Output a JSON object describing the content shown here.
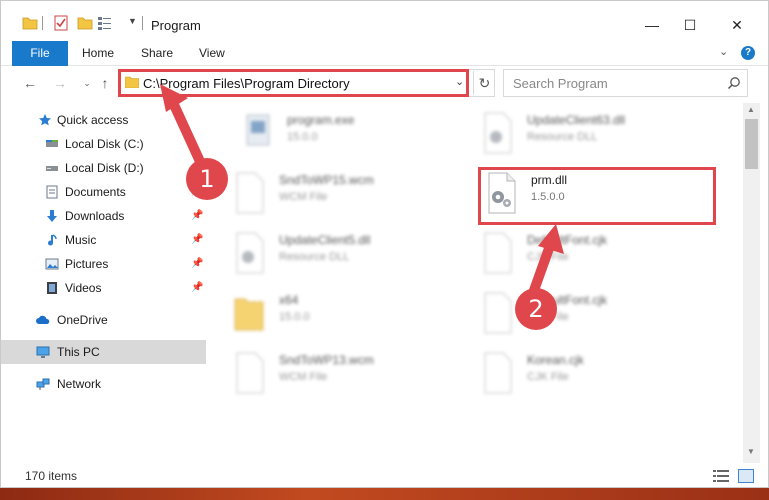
{
  "window": {
    "title": "Program"
  },
  "ribbon": {
    "tabs": [
      "File",
      "Home",
      "Share",
      "View"
    ],
    "help": "?"
  },
  "address": {
    "path": "C:\\Program Files\\Program Directory",
    "search_placeholder": "Search Program"
  },
  "sidebar": {
    "items": [
      {
        "label": "Quick access",
        "icon": "star-icon",
        "pinned": false
      },
      {
        "label": "Local Disk (C:)",
        "icon": "drive-icon",
        "pinned": false
      },
      {
        "label": "Local Disk (D:)",
        "icon": "drive-icon",
        "pinned": false
      },
      {
        "label": "Documents",
        "icon": "document-icon",
        "pinned": true
      },
      {
        "label": "Downloads",
        "icon": "download-icon",
        "pinned": true
      },
      {
        "label": "Music",
        "icon": "music-icon",
        "pinned": true
      },
      {
        "label": "Pictures",
        "icon": "picture-icon",
        "pinned": true
      },
      {
        "label": "Videos",
        "icon": "video-icon",
        "pinned": true
      },
      {
        "label": "OneDrive",
        "icon": "cloud-icon",
        "pinned": false
      },
      {
        "label": "This PC",
        "icon": "computer-icon",
        "pinned": false,
        "selected": true
      },
      {
        "label": "Network",
        "icon": "network-icon",
        "pinned": false
      }
    ]
  },
  "files": [
    {
      "name": "program.exe",
      "sub": "15.0.0",
      "icon": "exe-icon",
      "blurred": true
    },
    {
      "name": "UpdateClient63.dll",
      "sub": "Resource DLL",
      "icon": "dll-icon",
      "blurred": true
    },
    {
      "name": "SndToWP15.wcm",
      "sub": "WCM File",
      "icon": "file-icon",
      "blurred": true
    },
    {
      "name": "prm.dll",
      "sub": "1.5.0.0",
      "icon": "dll-icon",
      "blurred": false
    },
    {
      "name": "UpdateClient5.dll",
      "sub": "Resource DLL",
      "icon": "dll-icon",
      "blurred": true
    },
    {
      "name": "DefaultFont.cjk",
      "sub": "CJK File",
      "icon": "file-icon",
      "blurred": true
    },
    {
      "name": "x64",
      "sub": "15.0.0",
      "icon": "folder-icon",
      "blurred": true
    },
    {
      "name": "DefaultFont.cjk",
      "sub": "CJK File",
      "icon": "file-icon",
      "blurred": true
    },
    {
      "name": "SndToWP13.wcm",
      "sub": "WCM File",
      "icon": "file-icon",
      "blurred": true
    },
    {
      "name": "Korean.cjk",
      "sub": "CJK File",
      "icon": "file-icon",
      "blurred": true
    }
  ],
  "status": {
    "count": "170 items"
  },
  "callouts": [
    "1",
    "2"
  ],
  "colors": {
    "accent": "#1979ca",
    "callout": "#e0474c",
    "selected": "#d9d9d9"
  }
}
